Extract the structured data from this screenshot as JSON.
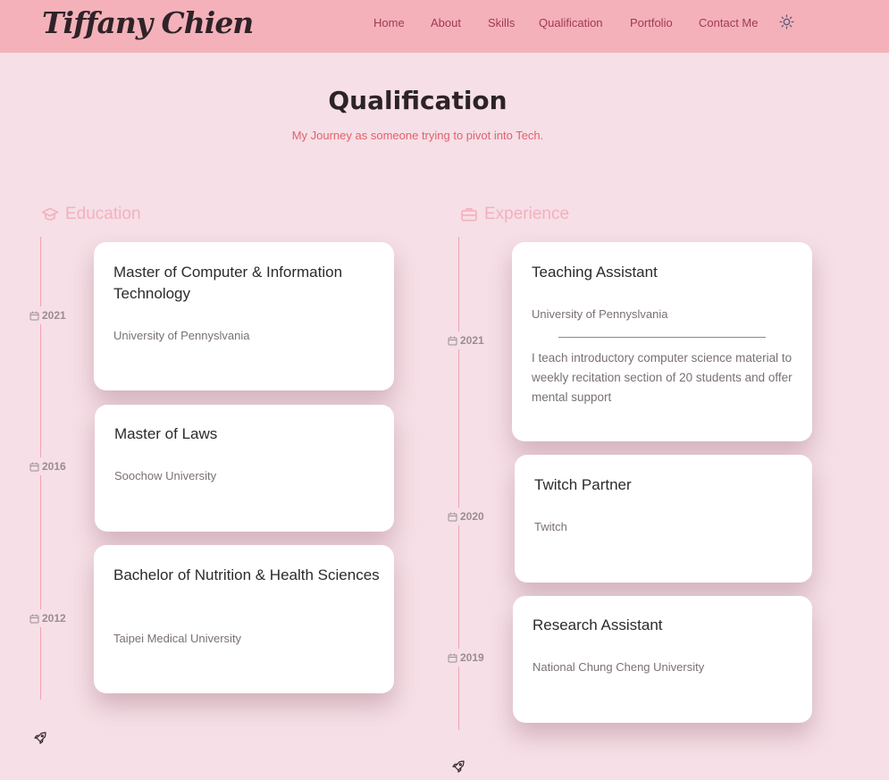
{
  "header": {
    "logo": "Tiffany Chien",
    "nav": [
      "Home",
      "About",
      "Skills",
      "Qualification",
      "Portfolio",
      "Contact Me"
    ],
    "theme_icon": "sun-icon"
  },
  "section": {
    "title": "Qualification",
    "subtitle": "My Journey as someone trying to pivot into Tech."
  },
  "tabs": {
    "education": {
      "label": "Education",
      "icon": "graduation-cap-icon"
    },
    "experience": {
      "label": "Experience",
      "icon": "briefcase-icon"
    }
  },
  "education": [
    {
      "title": "Master of Computer & Information Technology",
      "subtitle": "University of Pennyslvania",
      "year": "2021"
    },
    {
      "title": "Master of Laws",
      "subtitle": "Soochow University",
      "year": "2016"
    },
    {
      "title": "Bachelor of Nutrition & Health Sciences",
      "subtitle": "Taipei Medical University",
      "year": "2012"
    }
  ],
  "experience": [
    {
      "title": "Teaching Assistant",
      "subtitle": "University of Pennyslvania",
      "description": "I teach introductory computer science material to weekly recitation section of 20 students and offer mental support",
      "year": "2021"
    },
    {
      "title": "Twitch Partner",
      "subtitle": "Twitch",
      "year": "2020"
    },
    {
      "title": "Research Assistant",
      "subtitle": "National Chung Cheng University",
      "year": "2019"
    }
  ],
  "colors": {
    "header_bg": "#f4b1ba",
    "page_bg": "#f6dfe6",
    "accent": "#e0626e",
    "tab_accent": "#f3b1bd"
  }
}
